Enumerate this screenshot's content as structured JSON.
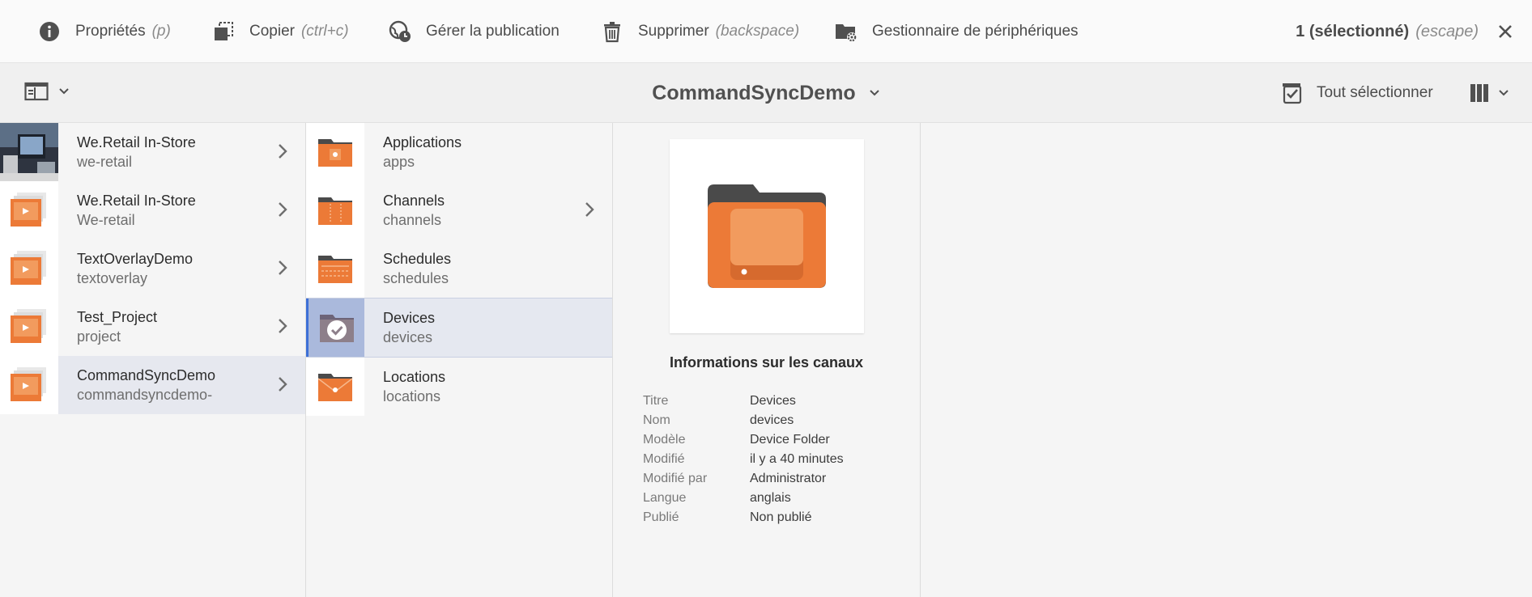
{
  "actionbar": {
    "actions": [
      {
        "label": "Propriétés",
        "shortcut": "(p)",
        "icon": "info-icon"
      },
      {
        "label": "Copier",
        "shortcut": "(ctrl+c)",
        "icon": "copy-icon"
      },
      {
        "label": "Gérer la publication",
        "shortcut": "",
        "icon": "globe-clock-icon"
      },
      {
        "label": "Supprimer",
        "shortcut": "(backspace)",
        "icon": "trash-icon"
      },
      {
        "label": "Gestionnaire de périphériques",
        "shortcut": "",
        "icon": "folder-gear-icon"
      }
    ],
    "selection_count": "1 (sélectionné)",
    "selection_shortcut": "(escape)"
  },
  "titlebar": {
    "title": "CommandSyncDemo",
    "select_all_label": "Tout sélectionner"
  },
  "column1": {
    "items": [
      {
        "title": "We.Retail In-Store",
        "subtitle": "we-retail",
        "thumb": "photo-thumbnail"
      },
      {
        "title": "We.Retail In-Store",
        "subtitle": "We-retail",
        "thumb": "project-icon"
      },
      {
        "title": "TextOverlayDemo",
        "subtitle": "textoverlay",
        "thumb": "project-icon"
      },
      {
        "title": "Test_Project",
        "subtitle": "project",
        "thumb": "project-icon"
      },
      {
        "title": "CommandSyncDemo",
        "subtitle": "commandsyncdemo-",
        "thumb": "project-icon"
      }
    ]
  },
  "column2": {
    "items": [
      {
        "title": "Applications",
        "subtitle": "apps",
        "thumb": "applications-folder-icon"
      },
      {
        "title": "Channels",
        "subtitle": "channels",
        "thumb": "channels-folder-icon"
      },
      {
        "title": "Schedules",
        "subtitle": "schedules",
        "thumb": "schedules-folder-icon"
      },
      {
        "title": "Devices",
        "subtitle": "devices",
        "thumb": "check-icon"
      },
      {
        "title": "Locations",
        "subtitle": "locations",
        "thumb": "locations-folder-icon"
      }
    ]
  },
  "preview": {
    "heading": "Informations sur les canaux",
    "props": [
      {
        "k": "Titre",
        "v": "Devices"
      },
      {
        "k": "Nom",
        "v": "devices"
      },
      {
        "k": "Modèle",
        "v": "Device Folder"
      },
      {
        "k": "Modifié",
        "v": "il y a 40 minutes"
      },
      {
        "k": "Modifié par",
        "v": "Administrator"
      },
      {
        "k": "Langue",
        "v": "anglais"
      },
      {
        "k": "Publié",
        "v": "Non publié"
      }
    ]
  },
  "colors": {
    "accent_orange": "#ec7a37",
    "selection_blue": "#3d6fd6"
  }
}
